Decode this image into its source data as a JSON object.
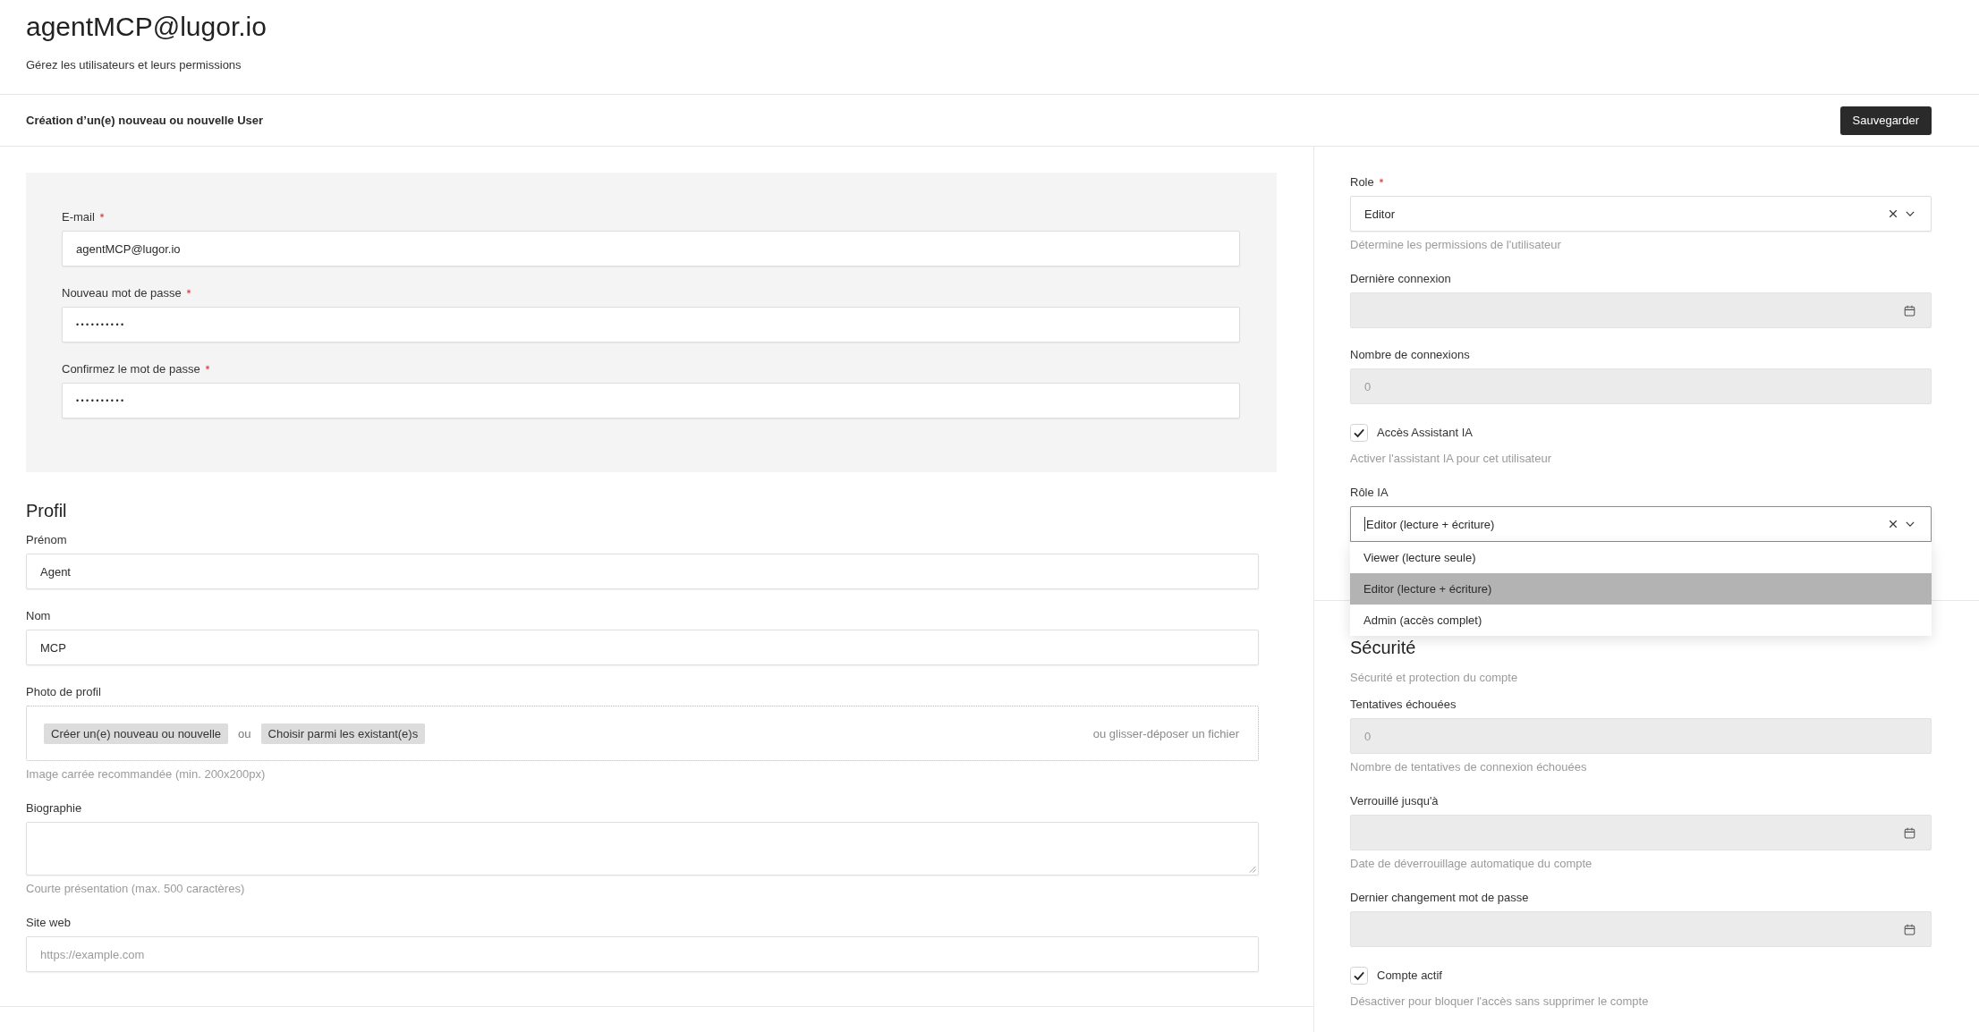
{
  "header": {
    "title": "agentMCP@lugor.io",
    "subtitle": "Gérez les utilisateurs et leurs permissions"
  },
  "toolbar": {
    "title": "Création d’un(e) nouveau ou nouvelle User",
    "save_button": "Sauvegarder"
  },
  "credentials": {
    "fields": [
      {
        "kind": "text",
        "label": "E-mail",
        "required": true,
        "value": "agentMCP@lugor.io"
      },
      {
        "kind": "password",
        "label": "Nouveau mot de passe",
        "required": true,
        "value": "••••••••••"
      },
      {
        "kind": "password",
        "label": "Confirmez le mot de passe",
        "required": true,
        "value": "••••••••••"
      }
    ]
  },
  "profile": {
    "heading": "Profil",
    "fields": [
      {
        "kind": "text",
        "label": "Prénom",
        "required": false,
        "value": "Agent"
      },
      {
        "kind": "text",
        "label": "Nom",
        "required": false,
        "value": "MCP"
      },
      {
        "kind": "file",
        "label": "Photo de profil",
        "required": false,
        "create_button": "Créer un(e) nouveau ou nouvelle",
        "separator": "ou",
        "choose_button": "Choisir parmi les existant(e)s",
        "drop_hint": "ou glisser-déposer un fichier",
        "help": "Image carrée recommandée (min. 200x200px)"
      },
      {
        "kind": "textarea",
        "label": "Biographie",
        "required": false,
        "help": "Courte présentation (max. 500 caractères)"
      },
      {
        "kind": "text",
        "label": "Site web",
        "required": false,
        "placeholder": "https://example.com"
      }
    ]
  },
  "settings": {
    "fields": [
      {
        "kind": "select",
        "label": "Role",
        "required": true,
        "disabled": false,
        "focused": false,
        "expanded": false,
        "value": "Editor",
        "help": "Détermine les permissions de l'utilisateur"
      },
      {
        "kind": "date",
        "label": "Dernière connexion",
        "required": false,
        "disabled": true
      },
      {
        "kind": "number",
        "label": "Nombre de connexions",
        "required": false,
        "disabled": true,
        "value": "0"
      },
      {
        "kind": "checkbox",
        "label": "Accès Assistant IA",
        "required": false,
        "disabled": false,
        "checked": true,
        "help": "Activer l'assistant IA pour cet utilisateur"
      },
      {
        "kind": "select",
        "label": "Rôle IA",
        "required": false,
        "disabled": false,
        "focused": true,
        "expanded": true,
        "value": "Editor (lecture + écriture)",
        "options": [
          {
            "label": "Viewer (lecture seule)",
            "selected": false
          },
          {
            "label": "Editor (lecture + écriture)",
            "selected": true
          },
          {
            "label": "Admin (accès complet)",
            "selected": false
          }
        ]
      }
    ]
  },
  "security": {
    "heading": "Sécurité",
    "description": "Sécurité et protection du compte",
    "fields": [
      {
        "kind": "number",
        "label": "Tentatives échouées",
        "required": false,
        "disabled": true,
        "value": "0",
        "help": "Nombre de tentatives de connexion échouées"
      },
      {
        "kind": "date",
        "label": "Verrouillé jusqu'à",
        "required": false,
        "disabled": true,
        "help": "Date de déverrouillage automatique du compte"
      },
      {
        "kind": "date",
        "label": "Dernier changement mot de passe",
        "required": false,
        "disabled": true
      },
      {
        "kind": "checkbox",
        "label": "Compte actif",
        "required": false,
        "disabled": false,
        "checked": true,
        "help": "Désactiver pour bloquer l'accès sans supprimer le compte"
      }
    ]
  }
}
